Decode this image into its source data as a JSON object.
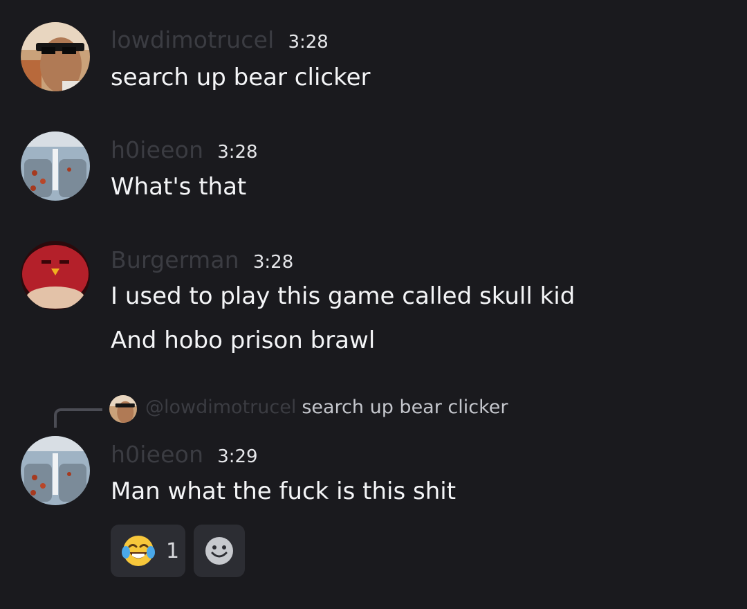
{
  "messages": [
    {
      "username": "lowdimotrucel",
      "time": "3:28",
      "lines": [
        "search up bear clicker"
      ]
    },
    {
      "username": "h0ieeon",
      "time": "3:28",
      "lines": [
        "What's that"
      ]
    },
    {
      "username": "Burgerman",
      "time": "3:28",
      "lines": [
        "I used to play this game called skull kid",
        "And hobo prison brawl"
      ]
    },
    {
      "username": "h0ieeon",
      "time": "3:29",
      "lines": [
        "Man what the fuck is this shit"
      ],
      "reply": {
        "mention": "@lowdimotrucel",
        "content": "search up bear clicker"
      },
      "reactions": [
        {
          "emoji_icon": "face-with-tears-of-joy-icon",
          "count": "1"
        }
      ]
    }
  ],
  "colors": {
    "background": "#1a1a1e",
    "username": "#3b3c42",
    "message_text": "#f4f5f7",
    "reaction_bg": "#2c2d33"
  },
  "icons": {
    "add_reaction": "add-reaction-smiley-icon"
  }
}
